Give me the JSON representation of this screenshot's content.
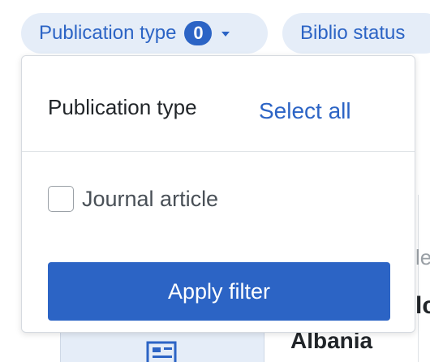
{
  "filters": {
    "publication_type": {
      "label": "Publication type",
      "count": "0"
    },
    "biblio_status": {
      "label": "Biblio status"
    }
  },
  "dropdown": {
    "title": "Publication type",
    "select_all_label": "Select all",
    "options": [
      {
        "label": "Journal article",
        "checked": false
      }
    ],
    "apply_label": "Apply filter"
  },
  "background": {
    "fragment_le": "le",
    "fragment_lc": "lc",
    "country": "Albania"
  },
  "colors": {
    "accent": "#2c64c5",
    "chip_bg": "#e5edf8"
  },
  "icons": {
    "chevron": "chevron-down-icon",
    "thumbnail": "document-icon"
  }
}
